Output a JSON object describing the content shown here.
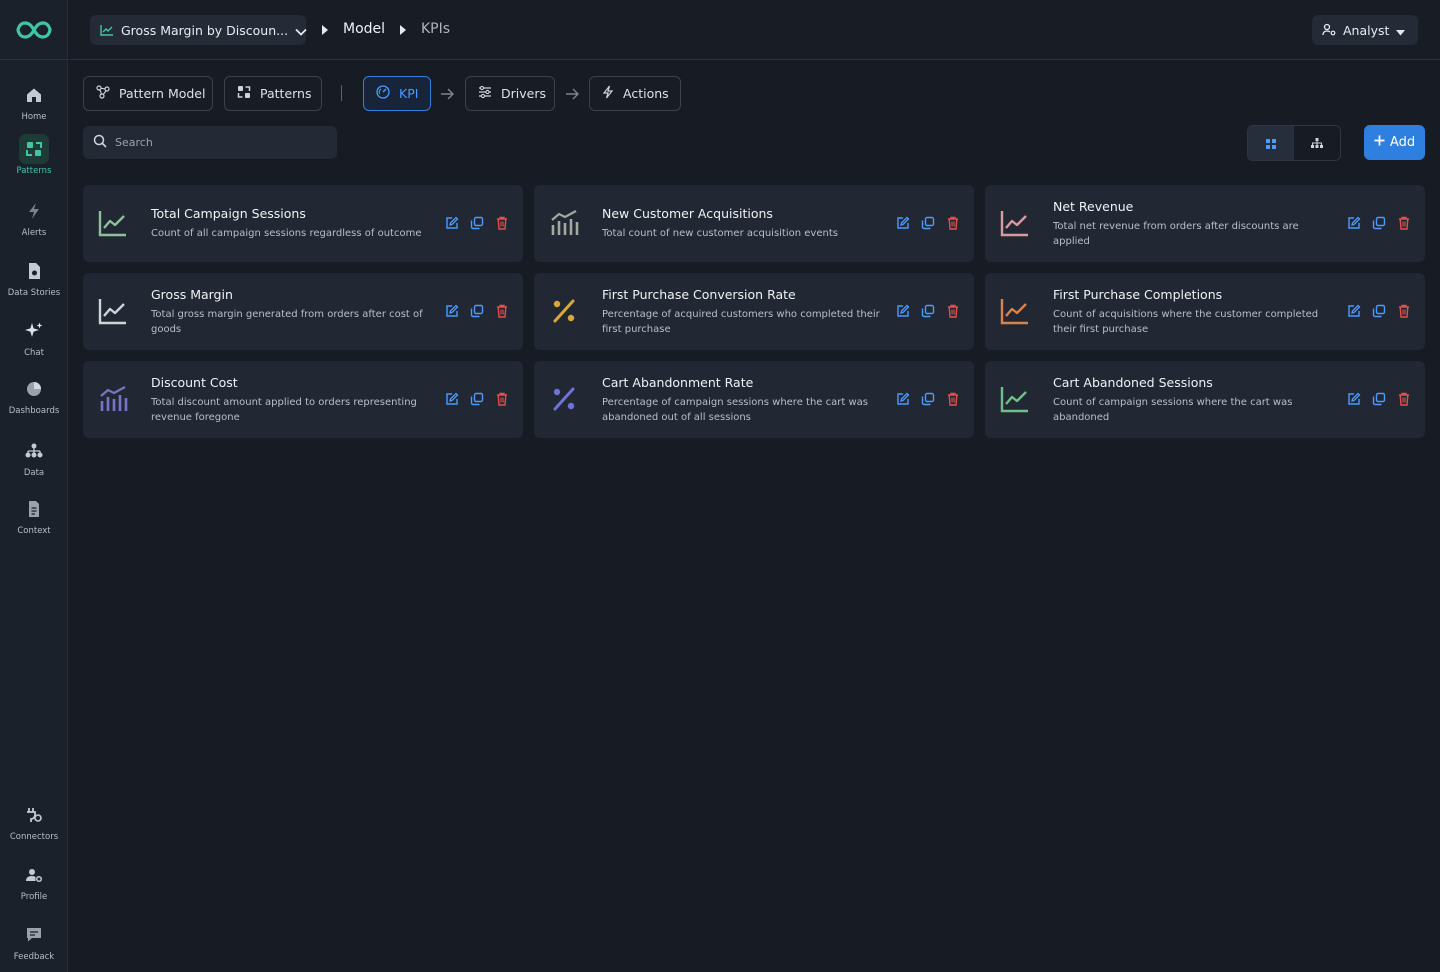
{
  "app": {
    "logo": "infinity-logo"
  },
  "sidebar": {
    "items": [
      {
        "label": "Home",
        "icon": "home-icon"
      },
      {
        "label": "Patterns",
        "icon": "patterns-icon",
        "active": true
      },
      {
        "label": "Alerts",
        "icon": "bolt-icon"
      },
      {
        "label": "Data Stories",
        "icon": "document-icon"
      },
      {
        "label": "Chat",
        "icon": "sparkle-icon"
      },
      {
        "label": "Dashboards",
        "icon": "pie-icon"
      },
      {
        "label": "Data",
        "icon": "hierarchy-icon"
      },
      {
        "label": "Context",
        "icon": "file-icon"
      }
    ],
    "bottom": [
      {
        "label": "Connectors",
        "icon": "plug-icon"
      },
      {
        "label": "Profile",
        "icon": "user-gear-icon"
      },
      {
        "label": "Feedback",
        "icon": "message-icon"
      }
    ]
  },
  "topbar": {
    "pattern_name": "Gross Margin by Discoun...",
    "breadcrumb": [
      "Model",
      "KPIs"
    ],
    "role": "Analyst"
  },
  "tabs": [
    {
      "label": "Pattern Model",
      "icon": "graph-icon"
    },
    {
      "label": "Patterns",
      "icon": "patterns-icon"
    },
    {
      "label": "KPI",
      "icon": "gauge-icon",
      "active": true
    },
    {
      "label": "Drivers",
      "icon": "sliders-icon"
    },
    {
      "label": "Actions",
      "icon": "bolt-icon"
    }
  ],
  "search": {
    "placeholder": "Search"
  },
  "add_button": "Add",
  "colors": {
    "accent": "#2f7fe0",
    "active_green": "#3ec7a7",
    "edit": "#4b9bff",
    "delete": "#e0524a"
  },
  "kpis": [
    {
      "title": "Total Campaign Sessions",
      "description": "Count of all campaign sessions regardless of outcome",
      "icon": "line-chart-icon",
      "color": "#8fbf96"
    },
    {
      "title": "New Customer Acquisitions",
      "description": "Total count of new customer acquisition events",
      "icon": "bar-trend-icon",
      "color": "#a3a8a0"
    },
    {
      "title": "Net Revenue",
      "description": "Total net revenue from orders after discounts are applied",
      "icon": "line-chart-icon",
      "color": "#d99aa0"
    },
    {
      "title": "Gross Margin",
      "description": "Total gross margin generated from orders after cost of goods",
      "icon": "line-chart-icon",
      "color": "#cfd3da"
    },
    {
      "title": "First Purchase Conversion Rate",
      "description": "Percentage of acquired customers who completed their first purchase",
      "icon": "percent-icon",
      "color": "#d9a73a"
    },
    {
      "title": "First Purchase Completions",
      "description": "Count of acquisitions where the customer completed their first purchase",
      "icon": "line-chart-icon",
      "color": "#d9824a"
    },
    {
      "title": "Discount Cost",
      "description": "Total discount amount applied to orders representing revenue foregone",
      "icon": "bar-trend-icon",
      "color": "#7a73c9"
    },
    {
      "title": "Cart Abandonment Rate",
      "description": "Percentage of campaign sessions where the cart was abandoned out of all sessions",
      "icon": "percent-icon",
      "color": "#6f72d6"
    },
    {
      "title": "Cart Abandoned Sessions",
      "description": "Count of campaign sessions where the cart was abandoned",
      "icon": "line-chart-icon",
      "color": "#6fbf8a"
    }
  ]
}
